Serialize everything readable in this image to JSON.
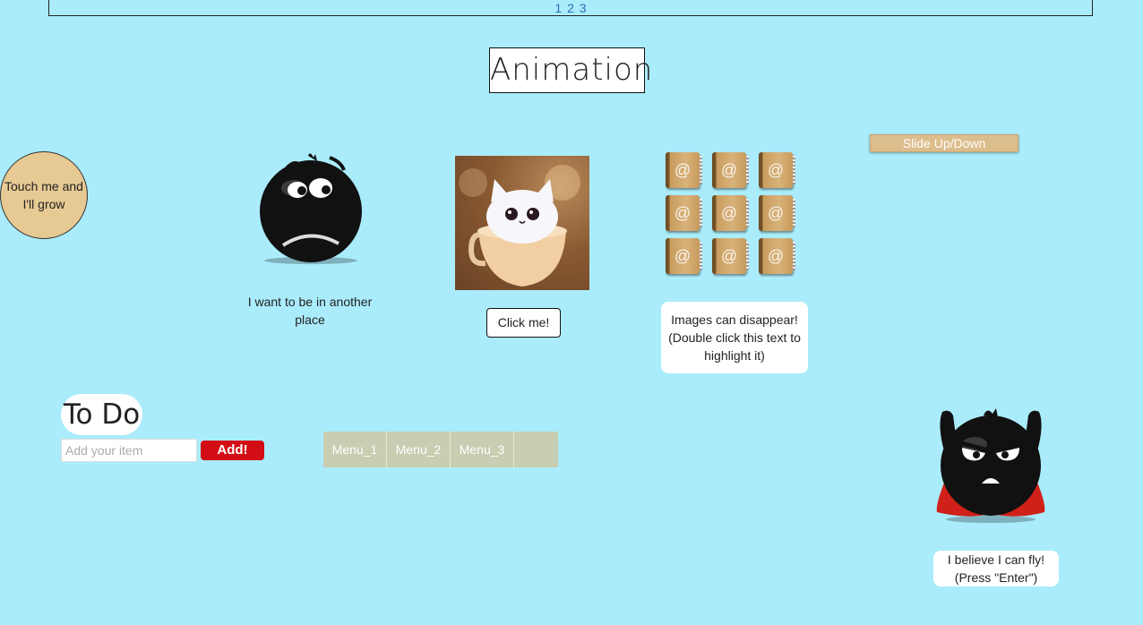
{
  "pager": {
    "pages": [
      "1",
      "2",
      "3"
    ]
  },
  "title": "Animation",
  "grow_circle": {
    "text": "Touch me and I'll grow"
  },
  "worried_emoji": {
    "caption": "I want to be in another place"
  },
  "kitten": {
    "button_label": "Click me!"
  },
  "books": {
    "icon": "address-book-icon",
    "count": 9,
    "caption": "Images can disappear! (Double click this text to highlight it)"
  },
  "slide": {
    "button_label": "Slide Up/Down"
  },
  "todo": {
    "title": "To Do",
    "input_placeholder": "Add your item",
    "add_label": "Add!"
  },
  "menu": {
    "items": [
      "Menu_1",
      "Menu_2",
      "Menu_3",
      ""
    ]
  },
  "hero_emoji": {
    "caption": "I believe I can fly! (Press \"Enter\")"
  },
  "colors": {
    "background": "#aaecfb",
    "circle": "#e7c993",
    "add_button": "#d20d16",
    "menu": "#c9cdb1",
    "slide_button": "#dcbd8c"
  }
}
